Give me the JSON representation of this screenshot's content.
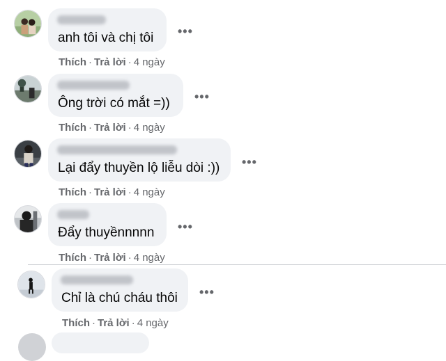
{
  "comments": [
    {
      "text": "anh tôi và chị tôi",
      "like": "Thích",
      "reply": "Trả lời",
      "sep": "·",
      "time": "4 ngày",
      "more": "•••"
    },
    {
      "text": "Ông trời có mắt =))",
      "like": "Thích",
      "reply": "Trả lời",
      "sep": "·",
      "time": "4 ngày",
      "more": "•••"
    },
    {
      "text": "Lại đẩy thuyền lộ liễu dòi :))",
      "like": "Thích",
      "reply": "Trả lời",
      "sep": "·",
      "time": "4 ngày",
      "more": "•••"
    },
    {
      "text": "Đẩy thuyềnnnnn",
      "like": "Thích",
      "reply": "Trả lời",
      "sep": "·",
      "time": "4 ngày",
      "more": "•••"
    },
    {
      "text": "Chỉ là chú cháu thôi",
      "like": "Thích",
      "reply": "Trả lời",
      "sep": "·",
      "time": "4 ngày",
      "more": "•••"
    }
  ],
  "colors": {
    "bubble": "#f0f2f5",
    "meta": "#65676b",
    "text": "#050505"
  },
  "icons": {
    "more": "more-options-icon"
  }
}
